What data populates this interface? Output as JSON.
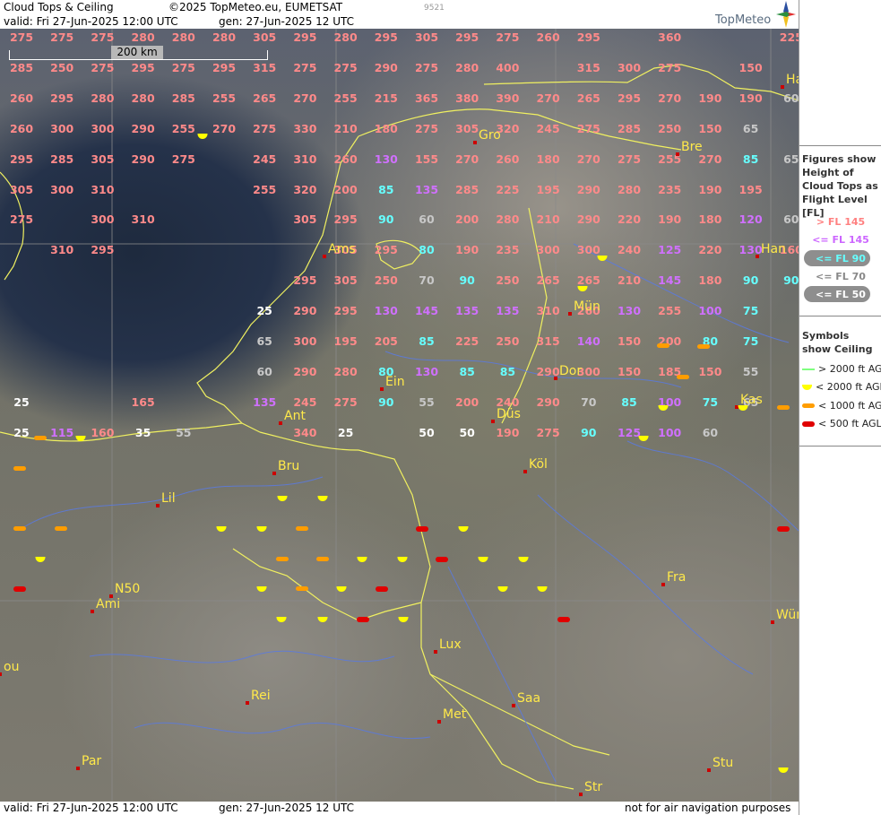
{
  "header": {
    "title": "Cloud Tops & Ceiling",
    "copyright": "©2025 TopMeteo.eu, EUMETSAT",
    "valid": "valid:  Fri  27-Jun-2025  12:00 UTC",
    "gen": "gen: 27-Jun-2025 12 UTC",
    "code": "9521",
    "brand": "TopMeteo"
  },
  "footer": {
    "valid": "valid:  Fri  27-Jun-2025  12:00 UTC",
    "gen": "gen: 27-Jun-2025 12 UTC",
    "notice": "not for air navigation purposes"
  },
  "scale": {
    "label": "200 km"
  },
  "legend": {
    "tops_title": "Figures show Height of Cloud Tops as Flight Level  [FL]",
    "fl_classes": [
      {
        "label": "> FL 145",
        "color": "#ff8080"
      },
      {
        "label": "<= FL 145",
        "color": "#cc66ff"
      },
      {
        "label": "<= FL 90",
        "color": "#66ffff"
      },
      {
        "label": "<= FL 70",
        "color": "#888888"
      },
      {
        "label": "<= FL 50",
        "color": "#ffffff"
      }
    ],
    "ceiling_title": "Symbols show Ceiling",
    "ceiling_classes": [
      {
        "label": "> 2000 ft AGL",
        "color": "#80ff80"
      },
      {
        "label": "< 2000 ft AGL",
        "color": "#ffff00"
      },
      {
        "label": "< 1000 ft AGL",
        "color": "#ff9d00"
      },
      {
        "label": "< 500 ft AGL",
        "color": "#e00000"
      }
    ]
  },
  "colors": {
    "high": "#ff8a8a",
    "mid": "#d070ff",
    "low": "#66ffff",
    "lower": "#c8c8c8",
    "lowest": "#ffffff",
    "city": "#ffe94a"
  },
  "cities": [
    {
      "name": "Gro"
    },
    {
      "name": "Bre"
    },
    {
      "name": "Ams"
    },
    {
      "name": "Han"
    },
    {
      "name": "Ha"
    },
    {
      "name": "Mün"
    },
    {
      "name": "Ein"
    },
    {
      "name": "Dor"
    },
    {
      "name": "Kas"
    },
    {
      "name": "Ant"
    },
    {
      "name": "Düs"
    },
    {
      "name": "Köl"
    },
    {
      "name": "Bru"
    },
    {
      "name": "Lil"
    },
    {
      "name": "N50"
    },
    {
      "name": "Ami"
    },
    {
      "name": "Fra"
    },
    {
      "name": "Wür"
    },
    {
      "name": "Lux"
    },
    {
      "name": "ou"
    },
    {
      "name": "Rei"
    },
    {
      "name": "Saa"
    },
    {
      "name": "Met"
    },
    {
      "name": "Par"
    },
    {
      "name": "Stu"
    },
    {
      "name": "Str"
    }
  ],
  "rows": [
    [
      "275",
      "275",
      "275",
      "280",
      "280",
      "280",
      "305",
      "295",
      "280",
      "295",
      "305",
      "295",
      "275",
      "260",
      "295",
      "",
      "360",
      "",
      "",
      "225"
    ],
    [
      "285",
      "250",
      "275",
      "295",
      "275",
      "295",
      "315",
      "275",
      "275",
      "290",
      "275",
      "280",
      "400",
      "",
      "315",
      "300",
      "275",
      "",
      "150",
      ""
    ],
    [
      "260",
      "295",
      "280",
      "280",
      "285",
      "255",
      "265",
      "270",
      "255",
      "215",
      "365",
      "380",
      "390",
      "270",
      "265",
      "295",
      "270",
      "190",
      "190",
      "60"
    ],
    [
      "260",
      "300",
      "300",
      "290",
      "255",
      "270",
      "275",
      "330",
      "210",
      "180",
      "275",
      "305",
      "320",
      "245",
      "275",
      "285",
      "250",
      "150",
      "65",
      ""
    ],
    [
      "295",
      "285",
      "305",
      "290",
      "275",
      "",
      "245",
      "310",
      "260",
      "130",
      "155",
      "270",
      "260",
      "180",
      "270",
      "275",
      "255",
      "270",
      "85",
      "65"
    ],
    [
      "305",
      "300",
      "310",
      "",
      "",
      "",
      "255",
      "320",
      "200",
      "85",
      "135",
      "285",
      "225",
      "195",
      "290",
      "280",
      "235",
      "190",
      "195",
      ""
    ],
    [
      "275",
      "",
      "300",
      "310",
      "",
      "",
      "",
      "305",
      "295",
      "90",
      "60",
      "200",
      "280",
      "210",
      "290",
      "220",
      "190",
      "180",
      "120",
      "60"
    ],
    [
      "",
      "310",
      "295",
      "",
      "",
      "",
      "",
      "",
      "305",
      "295",
      "80",
      "190",
      "235",
      "300",
      "300",
      "240",
      "125",
      "220",
      "130",
      "160"
    ],
    [
      "",
      "",
      "",
      "",
      "",
      "",
      "",
      "295",
      "305",
      "250",
      "70",
      "90",
      "250",
      "265",
      "265",
      "210",
      "145",
      "180",
      "90",
      "90"
    ],
    [
      "",
      "",
      "",
      "",
      "",
      "",
      "25",
      "290",
      "295",
      "130",
      "145",
      "135",
      "135",
      "310",
      "260",
      "130",
      "255",
      "100",
      "75",
      ""
    ],
    [
      "",
      "",
      "",
      "",
      "",
      "",
      "65",
      "300",
      "195",
      "205",
      "85",
      "225",
      "250",
      "315",
      "140",
      "150",
      "200",
      "80",
      "75",
      ""
    ],
    [
      "",
      "",
      "",
      "",
      "",
      "",
      "60",
      "290",
      "280",
      "80",
      "130",
      "85",
      "85",
      "290",
      "300",
      "150",
      "185",
      "150",
      "55",
      ""
    ],
    [
      "25",
      "",
      "",
      "165",
      "",
      "",
      "135",
      "245",
      "275",
      "90",
      "55",
      "200",
      "240",
      "290",
      "70",
      "85",
      "100",
      "75",
      "65",
      ""
    ],
    [
      "25",
      "115",
      "160",
      "35",
      "55",
      "",
      "",
      "340",
      "25",
      "",
      "50",
      "50",
      "190",
      "275",
      "90",
      "125",
      "100",
      "60",
      "",
      ""
    ]
  ]
}
